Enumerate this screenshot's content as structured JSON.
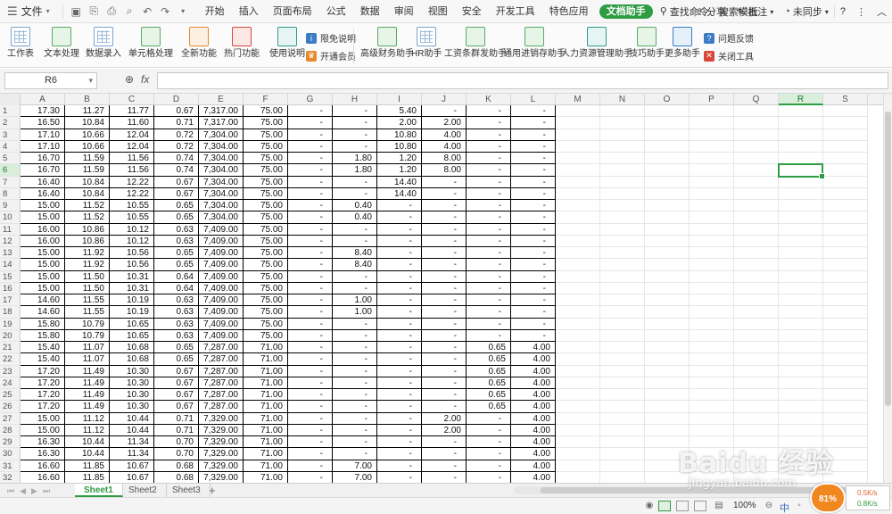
{
  "menubar": {
    "file_label": "文件",
    "tabs": [
      "开始",
      "插入",
      "页面布局",
      "公式",
      "数据",
      "审阅",
      "视图",
      "安全",
      "开发工具",
      "特色应用",
      "文档助手"
    ],
    "active_tab": "文档助手",
    "search_label": "查找命令、搜索模板",
    "share_label": "分享",
    "comment_label": "批注",
    "sync_label": "未同步",
    "help_label": "?"
  },
  "ribbon": {
    "buttons": [
      "工作表",
      "文本处理",
      "数据录入",
      "单元格处理",
      "全新功能",
      "热门功能",
      "使用说明",
      "高级财务助手",
      "HR助手",
      "工资条群发助手",
      "通用进销存助手",
      "人力资源管理助手",
      "技巧助手",
      "更多助手"
    ],
    "small_items": [
      "限免说明",
      "开通会员",
      "问题反馈",
      "关闭工具"
    ]
  },
  "formula_bar": {
    "name_box": "R6",
    "fx_label": "fx",
    "formula": ""
  },
  "sheet": {
    "columns": [
      "A",
      "B",
      "C",
      "D",
      "E",
      "F",
      "G",
      "H",
      "I",
      "J",
      "K",
      "L",
      "M",
      "N",
      "O",
      "P",
      "Q",
      "R",
      "S"
    ],
    "selected_cell": "R6",
    "rows": [
      {
        "n": "1",
        "v": [
          "17.30",
          "11.27",
          "11.77",
          "0.67",
          "7,317.00",
          "75.00",
          "-",
          "-",
          "5.40",
          "-",
          "-",
          "-"
        ]
      },
      {
        "n": "2",
        "v": [
          "16.50",
          "10.84",
          "11.60",
          "0.71",
          "7,317.00",
          "75.00",
          "-",
          "-",
          "2.00",
          "2.00",
          "-",
          "-"
        ]
      },
      {
        "n": "3",
        "v": [
          "17.10",
          "10.66",
          "12.04",
          "0.72",
          "7,304.00",
          "75.00",
          "-",
          "-",
          "10.80",
          "4.00",
          "-",
          "-"
        ]
      },
      {
        "n": "4",
        "v": [
          "17.10",
          "10.66",
          "12.04",
          "0.72",
          "7,304.00",
          "75.00",
          "-",
          "-",
          "10.80",
          "4.00",
          "-",
          "-"
        ]
      },
      {
        "n": "5",
        "v": [
          "16.70",
          "11.59",
          "11.56",
          "0.74",
          "7,304.00",
          "75.00",
          "-",
          "1.80",
          "1.20",
          "8.00",
          "-",
          "-"
        ]
      },
      {
        "n": "6",
        "v": [
          "16.70",
          "11.59",
          "11.56",
          "0.74",
          "7,304.00",
          "75.00",
          "-",
          "1.80",
          "1.20",
          "8.00",
          "-",
          "-"
        ]
      },
      {
        "n": "7",
        "v": [
          "16.40",
          "10.84",
          "12.22",
          "0.67",
          "7,304.00",
          "75.00",
          "-",
          "-",
          "14.40",
          "-",
          "-",
          "-"
        ]
      },
      {
        "n": "8",
        "v": [
          "16.40",
          "10.84",
          "12.22",
          "0.67",
          "7,304.00",
          "75.00",
          "-",
          "-",
          "14.40",
          "-",
          "-",
          "-"
        ]
      },
      {
        "n": "9",
        "v": [
          "15.00",
          "11.52",
          "10.55",
          "0.65",
          "7,304.00",
          "75.00",
          "-",
          "0.40",
          "-",
          "-",
          "-",
          "-"
        ]
      },
      {
        "n": "10",
        "v": [
          "15.00",
          "11.52",
          "10.55",
          "0.65",
          "7,304.00",
          "75.00",
          "-",
          "0.40",
          "-",
          "-",
          "-",
          "-"
        ]
      },
      {
        "n": "11",
        "v": [
          "16.00",
          "10.86",
          "10.12",
          "0.63",
          "7,409.00",
          "75.00",
          "-",
          "-",
          "-",
          "-",
          "-",
          "-"
        ]
      },
      {
        "n": "12",
        "v": [
          "16.00",
          "10.86",
          "10.12",
          "0.63",
          "7,409.00",
          "75.00",
          "-",
          "-",
          "-",
          "-",
          "-",
          "-"
        ]
      },
      {
        "n": "13",
        "v": [
          "15.00",
          "11.92",
          "10.56",
          "0.65",
          "7,409.00",
          "75.00",
          "-",
          "8.40",
          "-",
          "-",
          "-",
          "-"
        ]
      },
      {
        "n": "14",
        "v": [
          "15.00",
          "11.92",
          "10.56",
          "0.65",
          "7,409.00",
          "75.00",
          "-",
          "8.40",
          "-",
          "-",
          "-",
          "-"
        ]
      },
      {
        "n": "15",
        "v": [
          "15.00",
          "11.50",
          "10.31",
          "0.64",
          "7,409.00",
          "75.00",
          "-",
          "-",
          "-",
          "-",
          "-",
          "-"
        ]
      },
      {
        "n": "16",
        "v": [
          "15.00",
          "11.50",
          "10.31",
          "0.64",
          "7,409.00",
          "75.00",
          "-",
          "-",
          "-",
          "-",
          "-",
          "-"
        ]
      },
      {
        "n": "17",
        "v": [
          "14.60",
          "11.55",
          "10.19",
          "0.63",
          "7,409.00",
          "75.00",
          "-",
          "1.00",
          "-",
          "-",
          "-",
          "-"
        ]
      },
      {
        "n": "18",
        "v": [
          "14.60",
          "11.55",
          "10.19",
          "0.63",
          "7,409.00",
          "75.00",
          "-",
          "1.00",
          "-",
          "-",
          "-",
          "-"
        ]
      },
      {
        "n": "19",
        "v": [
          "15.80",
          "10.79",
          "10.65",
          "0.63",
          "7,409.00",
          "75.00",
          "-",
          "-",
          "-",
          "-",
          "-",
          "-"
        ]
      },
      {
        "n": "20",
        "v": [
          "15.80",
          "10.79",
          "10.65",
          "0.63",
          "7,409.00",
          "75.00",
          "-",
          "-",
          "-",
          "-",
          "-",
          "-"
        ]
      },
      {
        "n": "21",
        "v": [
          "15.40",
          "11.07",
          "10.68",
          "0.65",
          "7,287.00",
          "71.00",
          "-",
          "-",
          "-",
          "-",
          "0.65",
          "4.00"
        ]
      },
      {
        "n": "22",
        "v": [
          "15.40",
          "11.07",
          "10.68",
          "0.65",
          "7,287.00",
          "71.00",
          "-",
          "-",
          "-",
          "-",
          "0.65",
          "4.00"
        ]
      },
      {
        "n": "23",
        "v": [
          "17.20",
          "11.49",
          "10.30",
          "0.67",
          "7,287.00",
          "71.00",
          "-",
          "-",
          "-",
          "-",
          "0.65",
          "4.00"
        ]
      },
      {
        "n": "24",
        "v": [
          "17.20",
          "11.49",
          "10.30",
          "0.67",
          "7,287.00",
          "71.00",
          "-",
          "-",
          "-",
          "-",
          "0.65",
          "4.00"
        ]
      },
      {
        "n": "25",
        "v": [
          "17.20",
          "11.49",
          "10.30",
          "0.67",
          "7,287.00",
          "71.00",
          "-",
          "-",
          "-",
          "-",
          "0.65",
          "4.00"
        ]
      },
      {
        "n": "26",
        "v": [
          "17.20",
          "11.49",
          "10.30",
          "0.67",
          "7,287.00",
          "71.00",
          "-",
          "-",
          "-",
          "-",
          "0.65",
          "4.00"
        ]
      },
      {
        "n": "27",
        "v": [
          "15.00",
          "11.12",
          "10.44",
          "0.71",
          "7,329.00",
          "71.00",
          "-",
          "-",
          "-",
          "2.00",
          "-",
          "4.00"
        ]
      },
      {
        "n": "28",
        "v": [
          "15.00",
          "11.12",
          "10.44",
          "0.71",
          "7,329.00",
          "71.00",
          "-",
          "-",
          "-",
          "2.00",
          "-",
          "4.00"
        ]
      },
      {
        "n": "29",
        "v": [
          "16.30",
          "10.44",
          "11.34",
          "0.70",
          "7,329.00",
          "71.00",
          "-",
          "-",
          "-",
          "-",
          "-",
          "4.00"
        ]
      },
      {
        "n": "30",
        "v": [
          "16.30",
          "10.44",
          "11.34",
          "0.70",
          "7,329.00",
          "71.00",
          "-",
          "-",
          "-",
          "-",
          "-",
          "4.00"
        ]
      },
      {
        "n": "31",
        "v": [
          "16.60",
          "11.85",
          "10.67",
          "0.68",
          "7,329.00",
          "71.00",
          "-",
          "7.00",
          "-",
          "-",
          "-",
          "4.00"
        ]
      },
      {
        "n": "32",
        "v": [
          "16.60",
          "11.85",
          "10.67",
          "0.68",
          "7,329.00",
          "71.00",
          "-",
          "7.00",
          "-",
          "-",
          "-",
          "4.00"
        ]
      }
    ]
  },
  "sheet_tabs": [
    "Sheet1",
    "Sheet2",
    "Sheet3"
  ],
  "active_sheet": "Sheet1",
  "add_sheet_label": "+",
  "statusbar": {
    "zoom": "100%",
    "sys_tray": "中"
  },
  "perf_badge": "81%",
  "network": {
    "up": "0.5K/s",
    "down": "0.8K/s"
  },
  "watermark": {
    "brand": "Baidu 经验",
    "url": "jingyan.baidu.com"
  },
  "colors": {
    "accent": "#2e9c43",
    "badge": "#f0871f"
  }
}
